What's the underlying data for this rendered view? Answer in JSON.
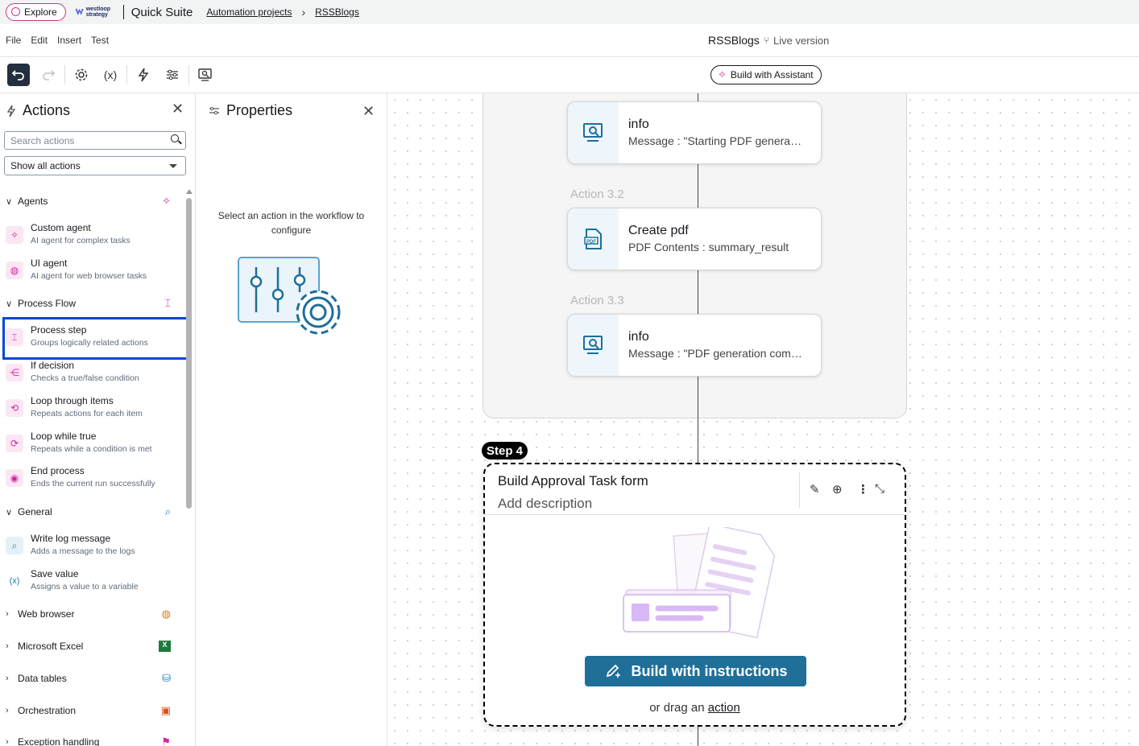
{
  "topbar": {
    "explore_label": "Explore",
    "logo_text": "westloop strategy",
    "suite_name": "Quick Suite",
    "breadcrumb": [
      "Automation projects",
      "RSSBlogs"
    ]
  },
  "menubar": {
    "items": [
      "File",
      "Edit",
      "Insert",
      "Test"
    ],
    "project_name": "RSSBlogs",
    "version_label": "Live version"
  },
  "toolbar": {
    "assistant_label": "Build with Assistant"
  },
  "actions_panel": {
    "title": "Actions",
    "search_placeholder": "Search actions",
    "filter_value": "Show all actions",
    "groups": {
      "agents": "Agents",
      "process_flow": "Process Flow",
      "general": "General",
      "web_browser": "Web browser",
      "excel": "Microsoft Excel",
      "data_tables": "Data tables",
      "orchestration": "Orchestration",
      "exception": "Exception handling"
    },
    "items": [
      {
        "title": "Custom agent",
        "desc": "AI agent for complex tasks"
      },
      {
        "title": "UI agent",
        "desc": "AI agent for web browser tasks"
      },
      {
        "title": "Process step",
        "desc": "Groups logically related actions"
      },
      {
        "title": "If decision",
        "desc": "Checks a true/false condition"
      },
      {
        "title": "Loop through items",
        "desc": "Repeats actions for each item"
      },
      {
        "title": "Loop while true",
        "desc": "Repeats while a condition is met"
      },
      {
        "title": "End process",
        "desc": "Ends the current run successfully"
      },
      {
        "title": "Write log message",
        "desc": "Adds a message to the logs"
      },
      {
        "title": "Save value",
        "desc": "Assigns a value to a variable"
      }
    ]
  },
  "properties_panel": {
    "title": "Properties",
    "empty_message": "Select an action in the workflow to configure"
  },
  "canvas": {
    "cards": [
      {
        "label": "",
        "title": "info",
        "subtitle": "Message : \"Starting PDF genera…"
      },
      {
        "label": "Action 3.2",
        "title": "Create pdf",
        "subtitle": "PDF Contents : summary_result"
      },
      {
        "label": "Action 3.3",
        "title": "info",
        "subtitle": "Message : \"PDF generation com…"
      }
    ],
    "step4": {
      "tag": "Step 4",
      "title": "Build Approval Task form",
      "description": "Add description",
      "build_button": "Build with instructions",
      "drag_prefix": "or drag an",
      "drag_link": "action"
    }
  },
  "colors": {
    "accent_pink": "#d6249f",
    "accent_blue": "#1d7fb8",
    "build_button": "#1f6f99",
    "highlight_border": "#0546d8"
  }
}
